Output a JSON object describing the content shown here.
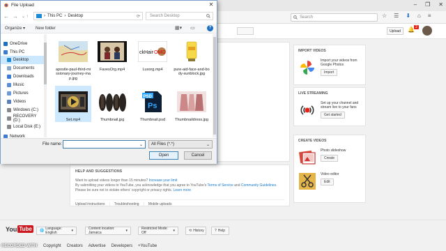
{
  "browser": {
    "search_placeholder": "Search",
    "win_controls": [
      "–",
      "❐",
      "✕"
    ]
  },
  "youtube": {
    "upload_label": "Upload",
    "notif_count": "2",
    "help": {
      "title": "HELP AND SUGGESTIONS",
      "line1_text": "Want to upload videos longer than 15 minutes? ",
      "line1_link": "Increase your limit",
      "line2_a": "By submitting your videos to YouTube, you acknowledge that you agree to YouTube's ",
      "line2_link1": "Terms of Service",
      "line2_b": " and ",
      "line2_link2": "Community Guidelines",
      "line2_c": ".",
      "line3": "Please be sure not to violate others' copyright or privacy rights. ",
      "line3_link": "Learn more",
      "links": [
        "Upload instructions",
        "Troubleshooting",
        "Mobile uploads"
      ]
    },
    "import": {
      "title": "IMPORT VIDEOS",
      "text": "Import your videos from Google Photos",
      "button": "Import"
    },
    "live": {
      "title": "LIVE STREAMING",
      "text": "Set up your channel and stream live to your fans",
      "button": "Get started"
    },
    "create": {
      "title": "CREATE VIDEOS",
      "slideshow": "Photo slideshow",
      "slideshow_btn": "Create",
      "editor": "Video editor",
      "editor_btn": "Edit"
    },
    "footer": {
      "logo_you": "You",
      "logo_tube": "Tube",
      "language": "Language: English",
      "location": "Content location: Jamaica",
      "restricted": "Restricted Mode: Off",
      "history": "History",
      "help": "Help",
      "links": [
        "Copyright",
        "Creators",
        "Advertise",
        "Developers",
        "+YouTube"
      ],
      "recorded": "RECORDED WITH"
    }
  },
  "dialog": {
    "title": "File Upload",
    "close": "✕",
    "path": [
      "This PC",
      "Desktop"
    ],
    "search_placeholder": "Search Desktop",
    "organize": "Organize ▾",
    "new_folder": "New folder",
    "help": "?",
    "nav": [
      {
        "label": "OneDrive",
        "level": "top",
        "color": "#1e6fc1"
      },
      {
        "label": "This PC",
        "level": "top",
        "color": "#3a7bd5"
      },
      {
        "label": "Desktop",
        "level": "sub",
        "color": "#1e8ad6",
        "selected": true
      },
      {
        "label": "Documents",
        "level": "sub",
        "color": "#8aa7c8"
      },
      {
        "label": "Downloads",
        "level": "sub",
        "color": "#3a7bd5"
      },
      {
        "label": "Music",
        "level": "sub",
        "color": "#5a8fd6"
      },
      {
        "label": "Pictures",
        "level": "sub",
        "color": "#6b9bd8"
      },
      {
        "label": "Videos",
        "level": "sub",
        "color": "#5b7fb8"
      },
      {
        "label": "Windows (C:)",
        "level": "sub",
        "color": "#888888"
      },
      {
        "label": "RECOVERY (D:)",
        "level": "sub",
        "color": "#888888"
      },
      {
        "label": "Local Disk (E:)",
        "level": "sub",
        "color": "#888888"
      },
      {
        "label": "Network",
        "level": "top",
        "color": "#3a7bd5"
      }
    ],
    "files": [
      {
        "name": "apostle-paul-third-missionary-journey-map.jpg",
        "kind": "map"
      },
      {
        "name": "FavesOrg.mp4",
        "kind": "video-people"
      },
      {
        "name": "Luxorg.mp4",
        "kind": "video-text",
        "overlay": "ckHairOMG"
      },
      {
        "name": "pure-aid-face-and-body-sunblock.jpg",
        "kind": "tube"
      },
      {
        "name": "Set.mp4",
        "kind": "video-set",
        "selected": true
      },
      {
        "name": "Thumbnail.jpg",
        "kind": "wigs"
      },
      {
        "name": "Thumbnail.psd",
        "kind": "psd",
        "overlay": "PSD"
      },
      {
        "name": "Thumbnaildress.jpg",
        "kind": "dress"
      }
    ],
    "filename_label": "File name:",
    "filename_value": "",
    "filetype": "All Files (*.*)",
    "open": "Open",
    "cancel": "Cancel"
  },
  "colors": {
    "youtube_red": "#cc181e",
    "link_blue": "#167ac6",
    "selection": "#cce8ff"
  }
}
